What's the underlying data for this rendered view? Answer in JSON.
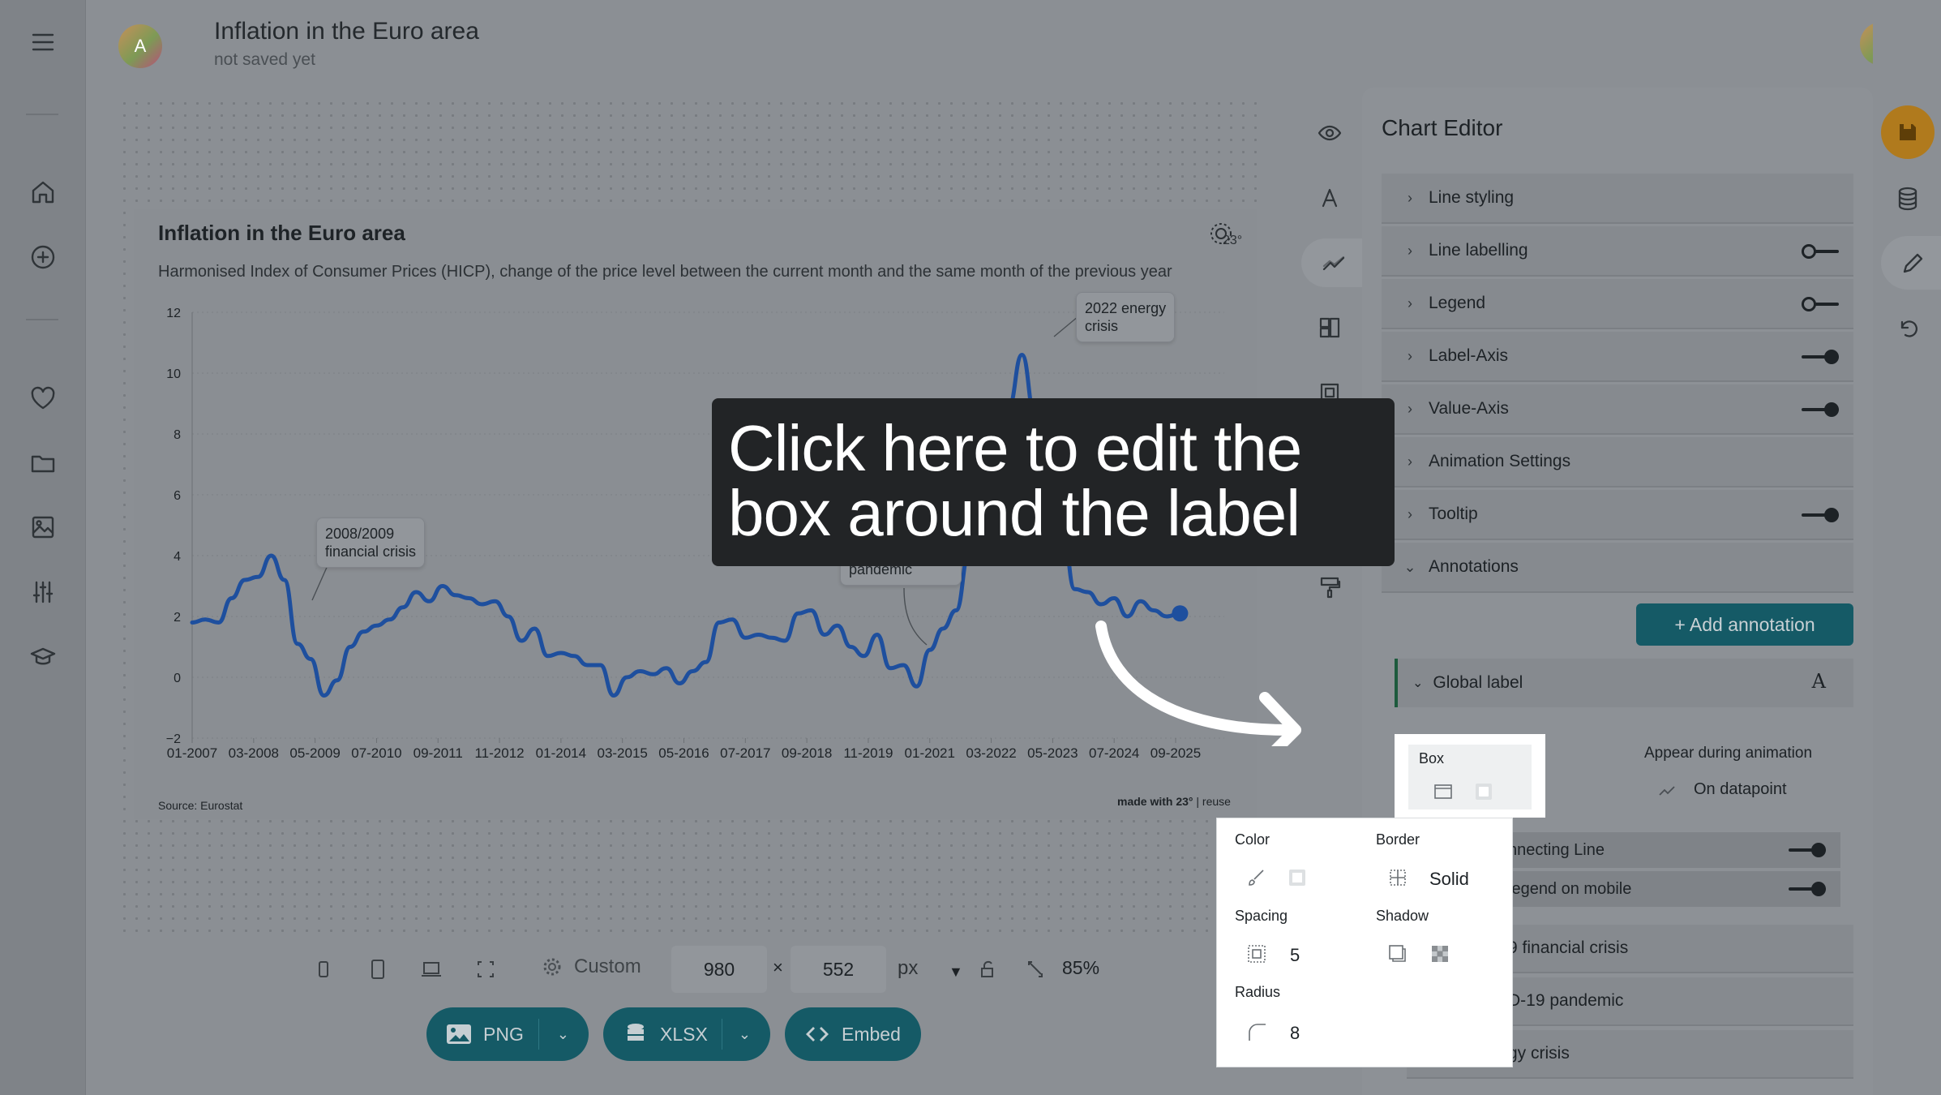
{
  "document": {
    "title": "Inflation in the Euro area",
    "save_status": "not saved yet",
    "avatar_initial": "A"
  },
  "left_nav": {
    "items": [
      {
        "icon": "menu-icon"
      },
      {
        "icon": "home-icon"
      },
      {
        "icon": "add-circle-icon"
      },
      {
        "icon": "heart-icon"
      },
      {
        "icon": "folder-icon"
      },
      {
        "icon": "image-icon"
      },
      {
        "icon": "sliders-icon"
      },
      {
        "icon": "graduation-cap-icon"
      }
    ]
  },
  "chart": {
    "title": "Inflation in the Euro area",
    "subtitle": "Harmonised Index of Consumer Prices (HICP), change of the price level between the current month and the same month of the previous year",
    "source": "Source: Eurostat",
    "credit_bold": "made with 23°",
    "credit_rest": " | reuse",
    "logo_text": "23°",
    "annotations": [
      {
        "text": "2008/2009\nfinancial crisis"
      },
      {
        "text": "2020 COVID-19\npandemic"
      },
      {
        "text": "2022 energy\ncrisis"
      }
    ]
  },
  "chart_data": {
    "type": "line",
    "title": "Inflation in the Euro area",
    "subtitle": "Harmonised Index of Consumer Prices (HICP), change of the price level between the current month and the same month of the previous year",
    "xlabel": "",
    "ylabel": "",
    "ylim": [
      -2,
      12
    ],
    "yticks": [
      -2,
      0,
      2,
      4,
      6,
      8,
      10,
      12
    ],
    "xticks": [
      "01-2007",
      "03-2008",
      "05-2009",
      "07-2010",
      "09-2011",
      "11-2012",
      "01-2014",
      "03-2015",
      "05-2016",
      "07-2017",
      "09-2018",
      "11-2019",
      "01-2021",
      "03-2022",
      "05-2023",
      "07-2024",
      "09-2025"
    ],
    "grid": true,
    "color": "#1e4f9e",
    "series": [
      {
        "x": [
          "01-2007",
          "04-2007",
          "07-2007",
          "10-2007",
          "01-2008",
          "04-2008",
          "07-2008",
          "10-2008",
          "01-2009",
          "04-2009",
          "07-2009",
          "10-2009",
          "01-2010",
          "04-2010",
          "07-2010",
          "10-2010",
          "01-2011",
          "04-2011",
          "07-2011",
          "10-2011",
          "01-2012",
          "04-2012",
          "07-2012",
          "10-2012",
          "01-2013",
          "04-2013",
          "07-2013",
          "10-2013",
          "01-2014",
          "04-2014",
          "07-2014",
          "10-2014",
          "01-2015",
          "04-2015",
          "07-2015",
          "10-2015",
          "01-2016",
          "04-2016",
          "07-2016",
          "10-2016",
          "01-2017",
          "04-2017",
          "07-2017",
          "10-2017",
          "01-2018",
          "04-2018",
          "07-2018",
          "10-2018",
          "01-2019",
          "04-2019",
          "07-2019",
          "10-2019",
          "01-2020",
          "04-2020",
          "07-2020",
          "10-2020",
          "01-2021",
          "04-2021",
          "07-2021",
          "10-2021",
          "01-2022",
          "04-2022",
          "07-2022",
          "10-2022",
          "01-2023",
          "04-2023",
          "07-2023",
          "10-2023",
          "01-2024",
          "04-2024",
          "07-2024",
          "10-2024",
          "01-2025",
          "04-2025",
          "07-2025",
          "10-2025"
        ],
        "values": [
          1.8,
          1.9,
          1.8,
          2.6,
          3.2,
          3.3,
          4.0,
          3.2,
          1.1,
          0.6,
          -0.6,
          -0.1,
          1.0,
          1.5,
          1.7,
          1.9,
          2.3,
          2.8,
          2.5,
          3.0,
          2.7,
          2.6,
          2.4,
          2.5,
          2.0,
          1.2,
          1.6,
          0.7,
          0.8,
          0.7,
          0.4,
          0.4,
          -0.6,
          0.0,
          0.2,
          0.1,
          0.3,
          -0.2,
          0.2,
          0.5,
          1.8,
          1.9,
          1.3,
          1.4,
          1.3,
          1.2,
          2.1,
          2.2,
          1.4,
          1.7,
          1.0,
          0.7,
          1.4,
          0.3,
          0.4,
          -0.3,
          0.9,
          1.6,
          2.2,
          4.1,
          5.1,
          7.4,
          8.9,
          10.6,
          8.6,
          7.0,
          5.3,
          2.9,
          2.8,
          2.4,
          2.6,
          2.0,
          2.5,
          2.2,
          2.0,
          2.1
        ]
      }
    ]
  },
  "tool_strip": {
    "items": [
      {
        "icon": "eye-icon"
      },
      {
        "icon": "font-icon"
      },
      {
        "icon": "line-chart-icon"
      },
      {
        "icon": "layout-icon"
      },
      {
        "icon": "frame-icon"
      },
      {
        "icon": "branch-icon"
      },
      {
        "icon": "gear-icon"
      },
      {
        "icon": "paint-roller-icon"
      }
    ]
  },
  "tooltip": {
    "text": "Click here to edit the box around the label"
  },
  "editor": {
    "heading": "Chart Editor",
    "sections": [
      {
        "label": "Line styling",
        "toggle": null
      },
      {
        "label": "Line labelling",
        "toggle": "off"
      },
      {
        "label": "Legend",
        "toggle": "off"
      },
      {
        "label": "Label-Axis",
        "toggle": "on"
      },
      {
        "label": "Value-Axis",
        "toggle": "on"
      },
      {
        "label": "Animation Settings",
        "toggle": null
      },
      {
        "label": "Tooltip",
        "toggle": "on"
      },
      {
        "label": "Annotations",
        "toggle": null
      }
    ],
    "add_annotation_label": "+ Add annotation",
    "global_label": "Global label",
    "appear_label": "Appear during animation",
    "appear_value": "On datapoint",
    "connecting_line_label": "nnecting Line",
    "legend_mobile_label": "legend on mobile",
    "annotation_items": [
      "9 financial crisis",
      "D-19 pandemic",
      "gy crisis"
    ]
  },
  "box_popup": {
    "label": "Box"
  },
  "style_popup": {
    "color_label": "Color",
    "border_label": "Border",
    "border_value": "Solid",
    "spacing_label": "Spacing",
    "spacing_value": "5",
    "shadow_label": "Shadow",
    "radius_label": "Radius",
    "radius_value": "8"
  },
  "bottom_bar": {
    "preset_label": "Custom",
    "width_value": "980",
    "height_value": "552",
    "times_symbol": "×",
    "unit": "px",
    "zoom": "85%"
  },
  "export": {
    "png_label": "PNG",
    "xlsx_label": "XLSX",
    "embed_label": "Embed"
  }
}
